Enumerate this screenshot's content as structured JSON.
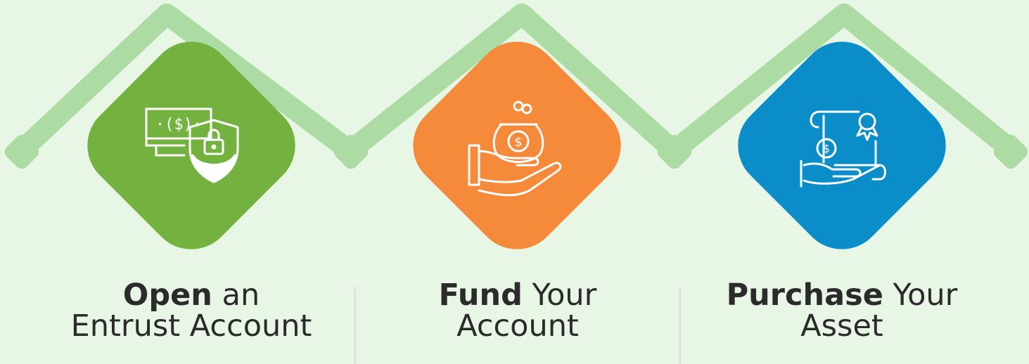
{
  "steps": [
    {
      "id": "open",
      "bold": "Open",
      "rest": " an",
      "line2": "Entrust Account",
      "color": "#74b23f",
      "icon": "money-bill-shield-lock-icon"
    },
    {
      "id": "fund",
      "bold": "Fund",
      "rest": " Your",
      "line2": "Account",
      "color": "#f58a3a",
      "icon": "hand-coin-purse-icon"
    },
    {
      "id": "purchase",
      "bold": "Purchase",
      "rest": " Your",
      "line2": "Asset",
      "color": "#0a8dc8",
      "icon": "hand-certificate-coin-icon"
    }
  ],
  "connector_color": "#acdba4"
}
